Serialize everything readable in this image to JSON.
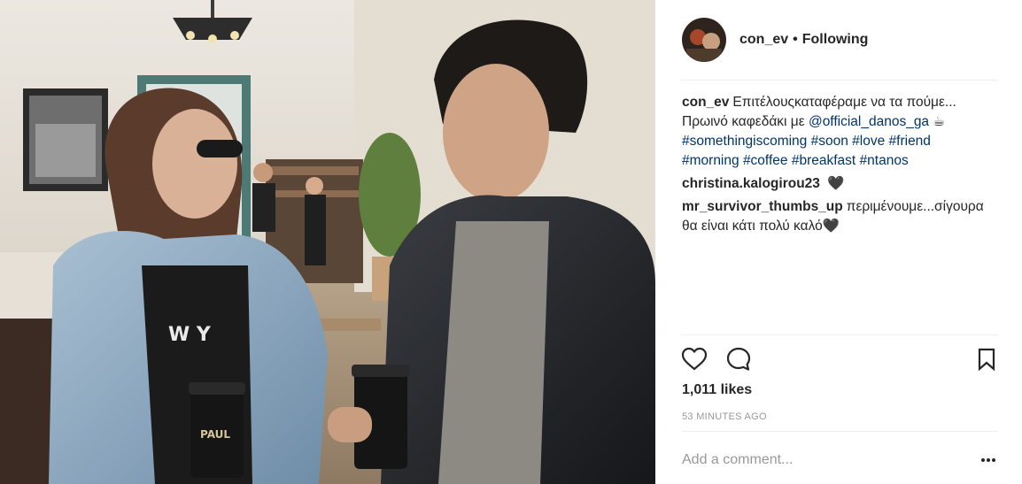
{
  "post": {
    "username": "con_ev",
    "separator": "•",
    "follow_state": "Following",
    "likes": "1,011 likes",
    "timestamp": "53 MINUTES AGO",
    "add_comment_placeholder": "Add a comment...",
    "more_glyph": "•••"
  },
  "photo": {
    "cup_brand": "PAUL",
    "shirt_text": "W Y"
  },
  "caption": {
    "user": "con_ev",
    "line1": "Επιτέλουςκαταφέραμε να τα πούμε...",
    "line2_prefix": "Πρωινό καφεδάκι με ",
    "mention": "@official_danos_ga",
    "emoji": "☕",
    "tags": [
      "#somethingiscoming",
      "#soon",
      "#love",
      "#friend",
      "#morning",
      "#coffee",
      "#breakfast",
      "#ntanos"
    ]
  },
  "comments": [
    {
      "user": "christina.kalogirou23",
      "text": "🖤"
    },
    {
      "user": "mr_survivor_thumbs_up",
      "text": "περιμένουμε...σίγουρα θα είναι κάτι πολύ καλό🖤"
    }
  ],
  "icons": {
    "like": "heart-outline-icon",
    "comment": "speech-bubble-icon",
    "save": "bookmark-icon",
    "more": "ellipsis-icon"
  },
  "colors": {
    "link": "#003569",
    "muted": "#999999",
    "text": "#262626",
    "divider": "#efefef"
  }
}
